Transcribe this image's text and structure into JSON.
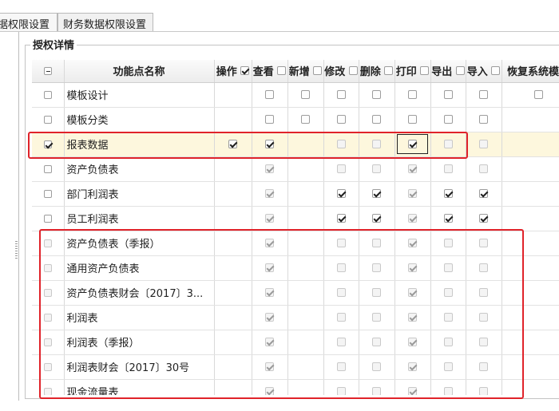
{
  "tabs": [
    "据权限设置",
    "财务数据权限设置"
  ],
  "section_title": "授权详情",
  "columns": {
    "name": "功能点名称",
    "operate": "操作",
    "view": "查看",
    "add": "新增",
    "edit": "修改",
    "delete": "删除",
    "print": "打印",
    "export": "导出",
    "import": "导入",
    "restore": "恢复系统模板"
  },
  "rows": [
    {
      "name": "模板设计",
      "cb": [
        "off",
        "",
        "off",
        "off",
        "off",
        "off",
        "off",
        "off",
        "off",
        "off"
      ]
    },
    {
      "name": "模板分类",
      "cb": [
        "off",
        "",
        "off",
        "off",
        "off",
        "off",
        "off",
        "off",
        "off",
        ""
      ]
    },
    {
      "name": "报表数据",
      "cb": [
        "on",
        "on",
        "on",
        "",
        "d",
        "d",
        "on",
        "d",
        "d",
        ""
      ]
    },
    {
      "name": "资产负债表",
      "cb": [
        "off",
        "",
        "dc",
        "",
        "d",
        "d",
        "dc",
        "d",
        "d",
        ""
      ]
    },
    {
      "name": "部门利润表",
      "cb": [
        "off",
        "",
        "dc",
        "",
        "on",
        "on",
        "dc",
        "on",
        "on",
        ""
      ]
    },
    {
      "name": "员工利润表",
      "cb": [
        "off",
        "",
        "dc",
        "",
        "on",
        "on",
        "dc",
        "on",
        "on",
        ""
      ]
    },
    {
      "name": "资产负债表（季报）",
      "cb": [
        "d",
        "",
        "dc",
        "",
        "d",
        "d",
        "dc",
        "d",
        "d",
        ""
      ]
    },
    {
      "name": "通用资产负债表",
      "cb": [
        "d",
        "",
        "dc",
        "",
        "d",
        "d",
        "dc",
        "d",
        "d",
        ""
      ]
    },
    {
      "name": "资产负债表财会〔2017〕3...",
      "cb": [
        "d",
        "",
        "dc",
        "",
        "d",
        "d",
        "dc",
        "d",
        "d",
        ""
      ]
    },
    {
      "name": "利润表",
      "cb": [
        "d",
        "",
        "dc",
        "",
        "d",
        "d",
        "dc",
        "d",
        "d",
        ""
      ]
    },
    {
      "name": "利润表（季报）",
      "cb": [
        "d",
        "",
        "dc",
        "",
        "d",
        "d",
        "dc",
        "d",
        "d",
        ""
      ]
    },
    {
      "name": "利润表财会〔2017〕30号",
      "cb": [
        "d",
        "",
        "dc",
        "",
        "d",
        "d",
        "dc",
        "d",
        "d",
        ""
      ]
    },
    {
      "name": "现金流量表",
      "cb": [
        "d",
        "",
        "dc",
        "",
        "d",
        "d",
        "dc",
        "d",
        "d",
        ""
      ]
    }
  ],
  "colors": {
    "annotation_red": "#e0232a",
    "selected_row": "#fdf7dd"
  }
}
